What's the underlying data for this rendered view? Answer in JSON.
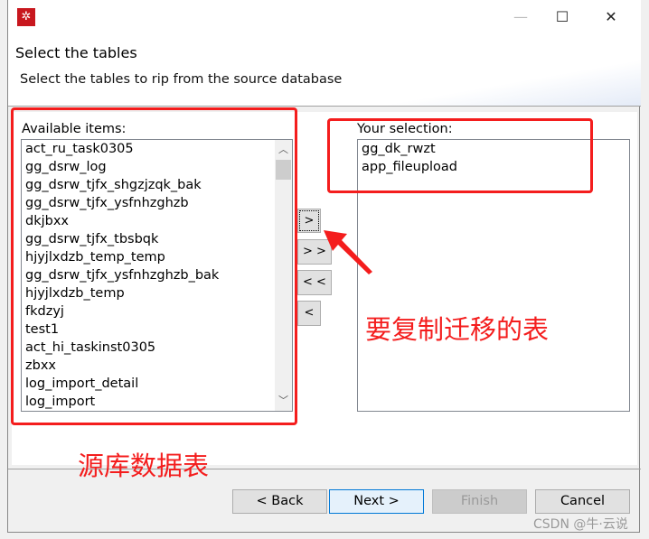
{
  "window": {
    "minimize": "—",
    "maximize": "☐",
    "close": "✕",
    "app_icon": "app-logo-icon"
  },
  "header": {
    "title": "Select the tables",
    "subtitle": "Select the tables to rip from the source database"
  },
  "available": {
    "label": "Available items:",
    "items": [
      "act_ru_task0305",
      "gg_dsrw_log",
      "gg_dsrw_tjfx_shgzjzqk_bak",
      "gg_dsrw_tjfx_ysfnhzghzb",
      "dkjbxx",
      "gg_dsrw_tjfx_tbsbqk",
      "hjyjlxdzb_temp_temp",
      "gg_dsrw_tjfx_ysfnhzghzb_bak",
      "hjyjlxdzb_temp",
      "fkdzyj",
      "test1",
      "act_hi_taskinst0305",
      "zbxx",
      "log_import_detail",
      "log_import"
    ]
  },
  "selection": {
    "label": "Your selection:",
    "items": [
      "gg_dk_rwzt",
      "app_fileupload"
    ]
  },
  "move": {
    "add": ">",
    "add_all": "> >",
    "remove_all": "< <",
    "remove": "<"
  },
  "buttons": {
    "back": "< Back",
    "next": "Next >",
    "finish": "Finish",
    "cancel": "Cancel"
  },
  "annotations": {
    "selection_note": "要复制迁移的表",
    "source_note": "源库数据表",
    "color": "#f41d1d"
  },
  "watermark": "CSDN @牛·云说"
}
